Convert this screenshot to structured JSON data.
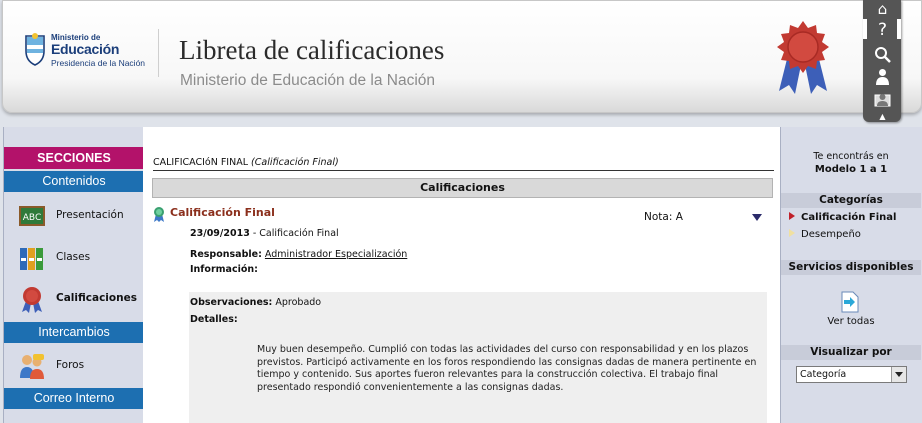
{
  "header": {
    "logo": {
      "line1": "Ministerio de",
      "line2": "Educación",
      "line3": "Presidencia de la Nación"
    },
    "title": "Libreta de calificaciones",
    "subtitle": "Ministerio de Educación de la Nación",
    "toolbar": {
      "icons": [
        "home-icon",
        "help-icon",
        "search-icon",
        "user-icon",
        "profile-icon",
        "arrow-up-icon"
      ]
    }
  },
  "left_sidebar": {
    "sections_label": "SECCIONES",
    "categories": [
      {
        "label": "Contenidos",
        "items": [
          {
            "label": "Presentación",
            "icon": "chalkboard-icon"
          },
          {
            "label": "Clases",
            "icon": "binders-icon"
          },
          {
            "label": "Calificaciones",
            "icon": "rosette-icon",
            "selected": true
          }
        ]
      },
      {
        "label": "Intercambios",
        "items": [
          {
            "label": "Foros",
            "icon": "people-icon"
          }
        ]
      },
      {
        "label": "Correo Interno",
        "items": []
      }
    ]
  },
  "main": {
    "breadcrumb": {
      "path": "CALIFICACIóN FINAL",
      "detail": "(Calificación Final)"
    },
    "section_title": "Calificaciones",
    "entry": {
      "title": "Calificación Final",
      "nota_label": "Nota:",
      "nota_value": "A",
      "date": "23/09/2013",
      "date_suffix": " - Calificación Final",
      "responsable_label": "Responsable:",
      "responsable_value": "Administrador Especialización",
      "informacion_label": "Información:",
      "observaciones_label": "Observaciones:",
      "observaciones_value": "Aprobado",
      "detalles_label": "Detalles:",
      "detalles_text": "Muy buen desempeño. Cumplió con todas las actividades del curso con responsabilidad y en los plazos previstos. Participó activamente en los foros respondiendo las consignas dadas de manera pertinente en tiempo y contenido. Sus aportes fueron relevantes para la construcción colectiva. El trabajo final presentado respondió convenientemente a las consignas dadas."
    }
  },
  "right_sidebar": {
    "location_line1": "Te encontrás en",
    "location_line2": "Modelo 1 a 1",
    "categorias_label": "Categorías",
    "categorias": [
      {
        "label": "Calificación Final",
        "selected": true
      },
      {
        "label": "Desempeño",
        "selected": false
      }
    ],
    "servicios_label": "Servicios disponibles",
    "ver_todas_label": "Ver todas",
    "visualizar_label": "Visualizar por",
    "visualizar_value": "Categoría"
  },
  "colors": {
    "secciones_bg": "#b3126a",
    "category_bg": "#1d6fb1",
    "entry_title": "#8b2f1c"
  }
}
